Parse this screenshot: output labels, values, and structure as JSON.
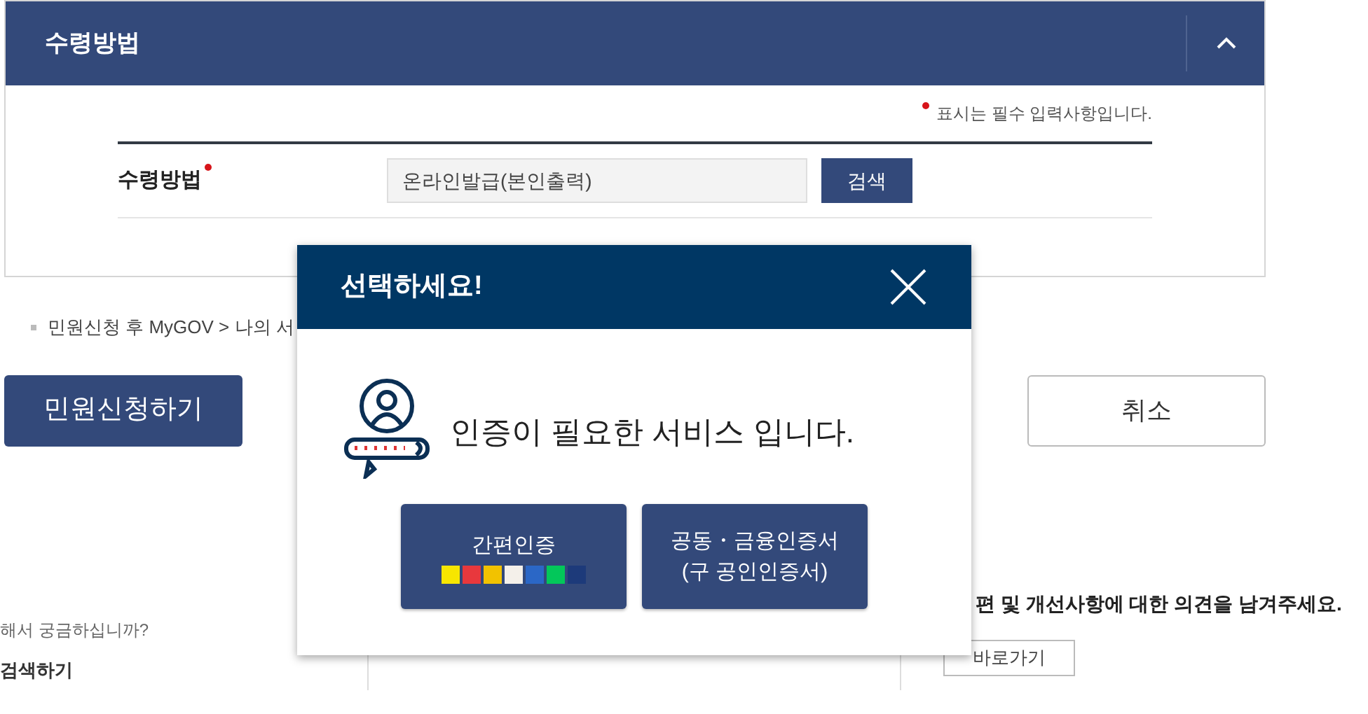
{
  "panel": {
    "title": "수령방법",
    "expanded": true,
    "required_note": "표시는 필수 입력사항입니다.",
    "field_label": "수령방법",
    "field_value": "온라인발급(본인출력)",
    "search_button": "검색"
  },
  "note": "민원신청 후 MyGOV > 나의 서",
  "buttons": {
    "apply": "민원신청하기",
    "cancel": "취소"
  },
  "footer": {
    "question": "해서 궁금하십니까?",
    "search_link": "검색하기",
    "feedback": "편 및 개선사항에 대한 의견을 남겨주세요.",
    "go_button": "바로가기"
  },
  "modal": {
    "title": "선택하세요!",
    "message": "인증이 필요한 서비스 입니다.",
    "options": [
      {
        "label": "간편인증",
        "logos": [
          {
            "color": "#f7e600"
          },
          {
            "color": "#e8383d"
          },
          {
            "color": "#f2c200"
          },
          {
            "color": "#f4f0ea"
          },
          {
            "color": "#2b67c6"
          },
          {
            "color": "#03c75a"
          },
          {
            "color": "#1d3a7a"
          }
        ]
      },
      {
        "label": "공동・금융인증서\n(구 공인인증서)"
      }
    ]
  }
}
